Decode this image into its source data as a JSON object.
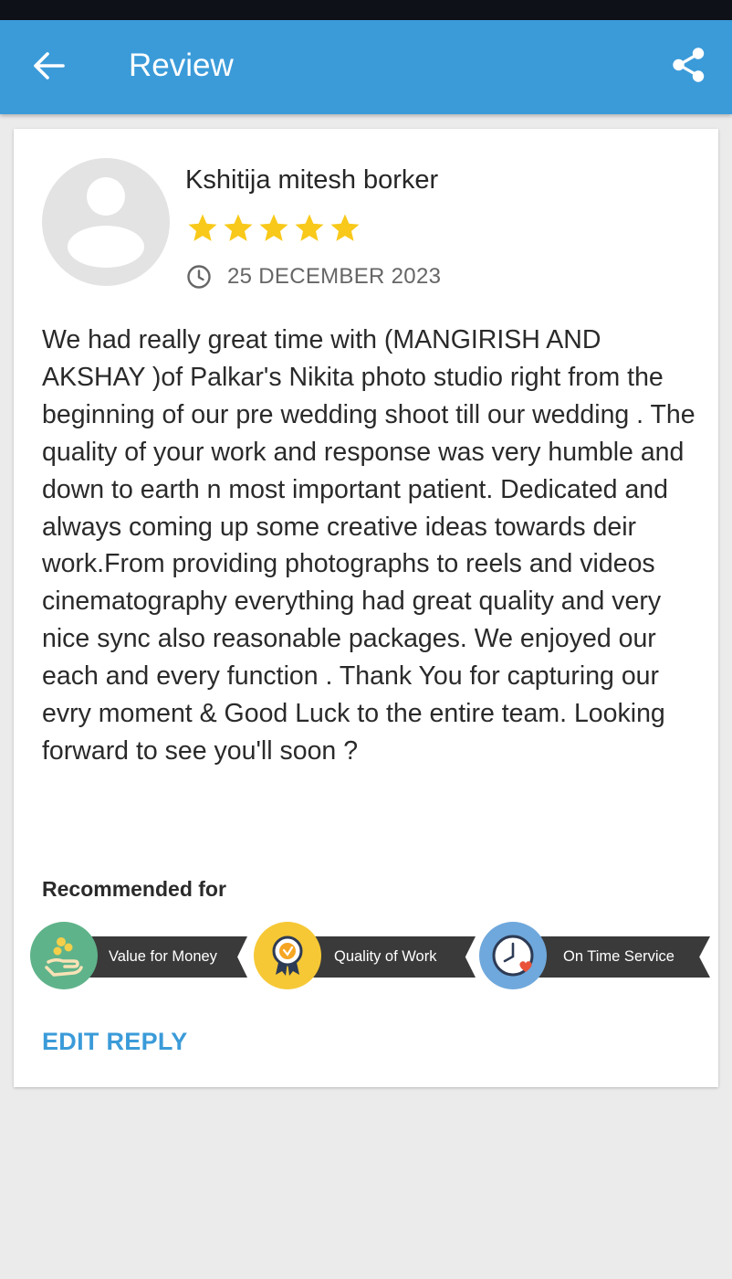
{
  "app_bar": {
    "title": "Review",
    "back_icon": "arrow-left-icon",
    "share_icon": "share-icon",
    "color": "#3b9bd9"
  },
  "review": {
    "reviewer_name": "Kshitija mitesh borker",
    "rating": 5,
    "rating_max": 5,
    "star_color": "#f8c91a",
    "date": "25 DECEMBER 2023",
    "body": "We had really great time with (MANGIRISH AND AKSHAY )of Palkar's Nikita photo studio right from the beginning of our pre wedding shoot till our wedding . The quality of your work and response was very humble and down to earth n most important patient. Dedicated and always coming up some creative ideas towards deir work.From providing photographs to reels and videos cinematography everything had great quality and very nice sync also reasonable packages. We enjoyed our each and every function . Thank You for capturing our evry moment & Good Luck to the entire team. Looking forward to see you'll soon ?"
  },
  "recommended": {
    "heading": "Recommended for",
    "badges": [
      {
        "label": "Value for Money",
        "icon": "money-hand-icon",
        "color": "#5fb38a"
      },
      {
        "label": "Quality of Work",
        "icon": "award-ribbon-icon",
        "color": "#f6c835"
      },
      {
        "label": "On Time Service",
        "icon": "clock-heart-icon",
        "color": "#6fa8dc"
      }
    ]
  },
  "actions": {
    "edit_reply": "EDIT REPLY"
  }
}
